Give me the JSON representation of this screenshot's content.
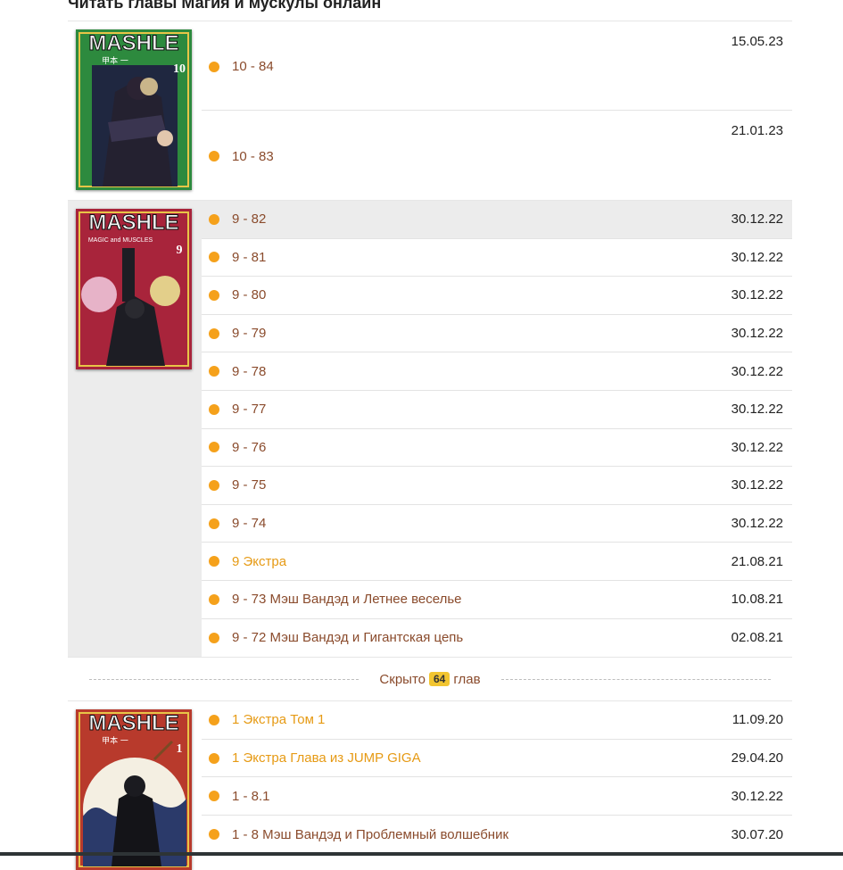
{
  "page": {
    "title": "Читать главы Магия и мускулы онлайн"
  },
  "volumes": [
    {
      "cover": {
        "logo": "MASHLE",
        "vol": "10",
        "bg": "#2d8a3e",
        "author": "甲本 一"
      },
      "chapters": [
        {
          "title": "10 - 84",
          "date": "15.05.23"
        },
        {
          "title": "10 - 83",
          "date": "21.01.23"
        }
      ]
    },
    {
      "cover": {
        "logo": "MASHLE",
        "vol": "9",
        "bg": "#a8243b",
        "subtitle": "MAGIC and MUSCLES"
      },
      "chapters": [
        {
          "title": "9 - 82",
          "date": "30.12.22"
        },
        {
          "title": "9 - 81",
          "date": "30.12.22"
        },
        {
          "title": "9 - 80",
          "date": "30.12.22"
        },
        {
          "title": "9 - 79",
          "date": "30.12.22"
        },
        {
          "title": "9 - 78",
          "date": "30.12.22"
        },
        {
          "title": "9 - 77",
          "date": "30.12.22"
        },
        {
          "title": "9 - 76",
          "date": "30.12.22"
        },
        {
          "title": "9 - 75",
          "date": "30.12.22"
        },
        {
          "title": "9 - 74",
          "date": "30.12.22"
        },
        {
          "title": "9 Экстра",
          "date": "21.08.21"
        },
        {
          "title": "9 - 73 Мэш Вандэд и Летнее веселье",
          "date": "10.08.21"
        },
        {
          "title": "9 - 72 Мэш Вандэд и Гигантская цепь",
          "date": "02.08.21"
        }
      ]
    },
    {
      "cover": {
        "logo": "MASHLE",
        "vol": "1",
        "bg": "#b83a2c",
        "author": "甲本 一"
      },
      "chapters": [
        {
          "title": "1 Экстра Том 1",
          "date": "11.09.20"
        },
        {
          "title": "1 Экстра Глава из JUMP GIGA",
          "date": "29.04.20"
        },
        {
          "title": "1 - 8.1",
          "date": "30.12.22"
        },
        {
          "title": "1 - 8 Мэш Вандэд и Проблемный волшебник",
          "date": "30.07.20"
        }
      ]
    }
  ],
  "hidden": {
    "prefix": "Скрыто",
    "count": "64",
    "suffix": "глав"
  },
  "colors": {
    "accent": "#f5a11b",
    "link": "#8a4b2c",
    "extra_link": "#e69a14",
    "badge": "#f2c530"
  }
}
